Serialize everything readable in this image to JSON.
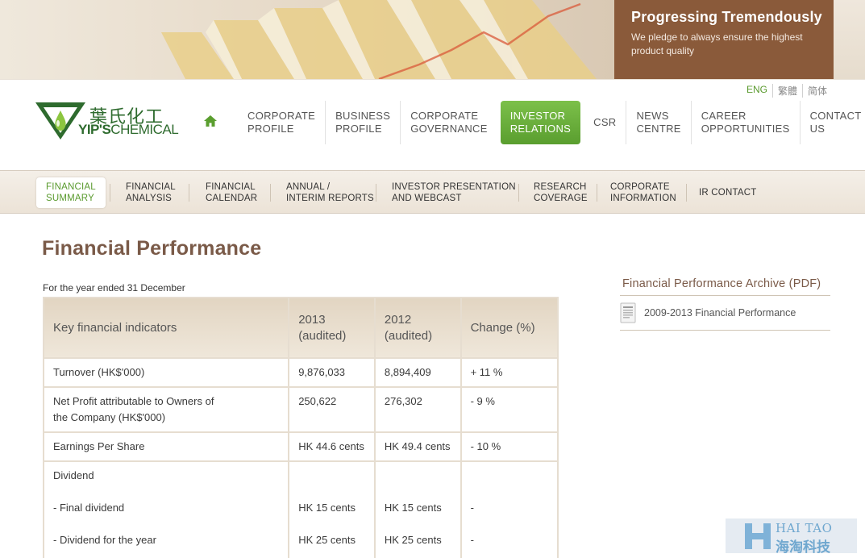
{
  "banner": {
    "title": "Progressing Tremendously",
    "subtitle": "We pledge to always ensure the highest product quality"
  },
  "languages": [
    "ENG",
    "繁體",
    "简体"
  ],
  "logo": {
    "chinese": "葉氏化工",
    "english_bold": "YIP'S",
    "english_light": "CHEMICAL"
  },
  "main_nav": [
    {
      "label": "CORPORATE\nPROFILE",
      "active": false
    },
    {
      "label": "BUSINESS\nPROFILE",
      "active": false
    },
    {
      "label": "CORPORATE\nGOVERNANCE",
      "active": false
    },
    {
      "label": "INVESTOR\nRELATIONS",
      "active": true
    },
    {
      "label": "CSR",
      "active": false
    },
    {
      "label": "NEWS\nCENTRE",
      "active": false
    },
    {
      "label": "CAREER\nOPPORTUNITIES",
      "active": false
    },
    {
      "label": "CONTACT US",
      "active": false
    }
  ],
  "sub_nav": [
    {
      "label": "FINANCIAL\nSUMMARY",
      "active": true
    },
    {
      "label": "FINANCIAL\nANALYSIS",
      "active": false
    },
    {
      "label": "FINANCIAL\nCALENDAR",
      "active": false
    },
    {
      "label": "ANNUAL /\nINTERIM REPORTS",
      "active": false
    },
    {
      "label": "INVESTOR PRESENTATION\nAND WEBCAST",
      "active": false
    },
    {
      "label": "RESEARCH\nCOVERAGE",
      "active": false
    },
    {
      "label": "CORPORATE\nINFORMATION",
      "active": false
    },
    {
      "label": "IR CONTACT",
      "active": false
    }
  ],
  "page_title": "Financial Performance",
  "year_note": "For the year ended 31 December",
  "table": {
    "headers": [
      "Key financial indicators",
      "2013\n(audited)",
      "2012\n(audited)",
      "Change (%)"
    ],
    "rows": [
      {
        "label": "Turnover (HK$'000)",
        "v2013": "9,876,033",
        "v2012": "8,894,409",
        "change": "+ 11 %"
      },
      {
        "label": "Net Profit attributable to Owners of the Company (HK$'000)",
        "v2013": "250,622",
        "v2012": "276,302",
        "change": "- 9 %"
      },
      {
        "label": "Earnings Per Share",
        "v2013": "HK 44.6 cents",
        "v2012": "HK 49.4 cents",
        "change": "- 10 %"
      }
    ],
    "dividend": {
      "label": "Dividend",
      "final_label": "- Final dividend",
      "final_2013": "HK 15 cents",
      "final_2012": "HK 15 cents",
      "final_change": "-",
      "year_label": "- Dividend for the year",
      "year_2013": "HK 25 cents",
      "year_2012": "HK 25 cents",
      "year_change": "-"
    }
  },
  "archive": {
    "title": "Financial Performance Archive (PDF)",
    "link": "2009-2013 Financial Performance"
  },
  "watermark": {
    "en": "HAI TAO",
    "cn": "海淘科技"
  }
}
